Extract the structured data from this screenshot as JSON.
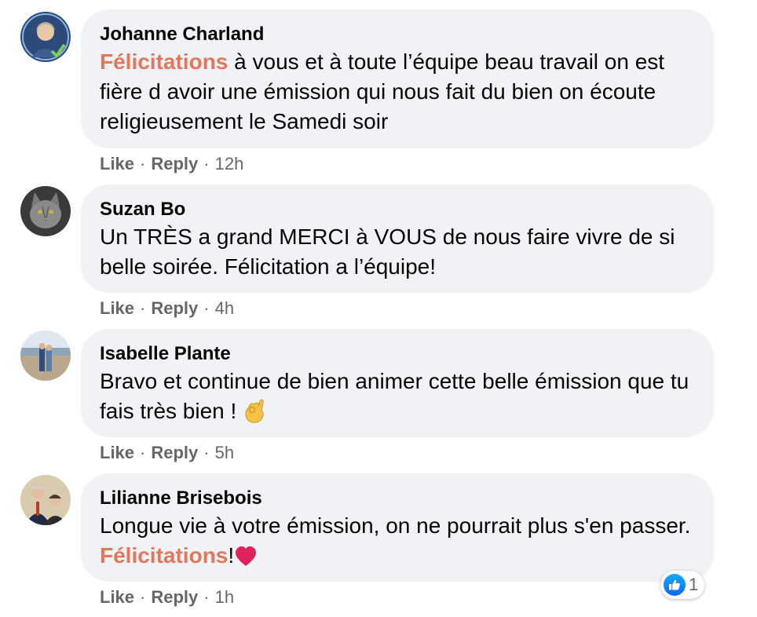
{
  "comments": [
    {
      "author": "Johanne Charland",
      "highlight": "Félicitations",
      "text_after": " à vous et à toute l’équipe beau travail on est fière d avoir une émission qui nous fait du bien on écoute religieusement le Samedi soir",
      "time": "12h"
    },
    {
      "author": "Suzan Bo",
      "text": "Un TRÈS a grand MERCI à VOUS de nous faire vivre de si belle soirée. Félicitation a l’équipe!",
      "time": "4h"
    },
    {
      "author": "Isabelle Plante",
      "text": "Bravo et continue de bien animer cette belle émission que tu fais très bien ! ",
      "emoji": "ok-hand-icon",
      "time": "5h"
    },
    {
      "author": "Lilianne Brisebois",
      "text_before": "Longue vie à votre émission, on ne pourrait plus s'en passer. ",
      "highlight": "Félicitations",
      "text_after": "!",
      "emoji": "red-heart-icon",
      "time": "1h",
      "reaction_count": "1"
    }
  ],
  "actions": {
    "like": "Like",
    "reply": "Reply",
    "dot": "·"
  },
  "colors": {
    "highlight": "#e0785d",
    "bubble": "#f0f2f5",
    "meta": "#65676b",
    "like_blue": "#0866ff"
  }
}
